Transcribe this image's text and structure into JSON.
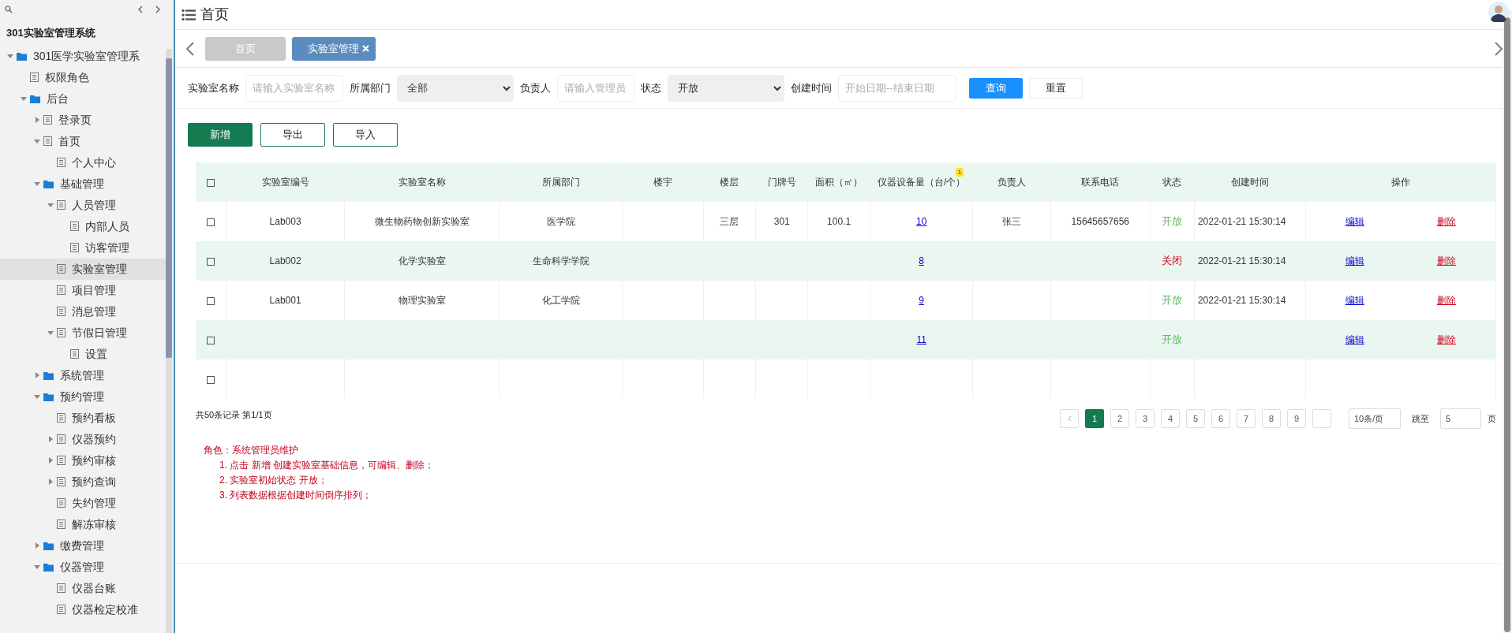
{
  "sidebar": {
    "title": "301实验室管理系统",
    "tree": [
      {
        "label": "301医学实验室管理系",
        "kind": "folder",
        "expanded": true,
        "selected": false,
        "children": [
          {
            "label": "权限角色",
            "kind": "page",
            "selected": false
          },
          {
            "label": "后台",
            "kind": "folder",
            "expanded": true,
            "selected": false,
            "children": [
              {
                "label": "登录页",
                "kind": "page",
                "expanded": false,
                "selected": false
              },
              {
                "label": "首页",
                "kind": "page",
                "expanded": true,
                "selected": false,
                "children": [
                  {
                    "label": "个人中心",
                    "kind": "page",
                    "selected": false
                  }
                ]
              },
              {
                "label": "基础管理",
                "kind": "folder",
                "expanded": true,
                "selected": false,
                "children": [
                  {
                    "label": "人员管理",
                    "kind": "page",
                    "expanded": true,
                    "selected": false,
                    "children": [
                      {
                        "label": "内部人员",
                        "kind": "page",
                        "selected": false
                      },
                      {
                        "label": "访客管理",
                        "kind": "page",
                        "selected": false
                      }
                    ]
                  },
                  {
                    "label": "实验室管理",
                    "kind": "page",
                    "selected": true
                  },
                  {
                    "label": "项目管理",
                    "kind": "page",
                    "selected": false
                  },
                  {
                    "label": "消息管理",
                    "kind": "page",
                    "selected": false
                  },
                  {
                    "label": "节假日管理",
                    "kind": "page",
                    "expanded": true,
                    "selected": false,
                    "children": [
                      {
                        "label": "设置",
                        "kind": "page",
                        "selected": false
                      }
                    ]
                  }
                ]
              },
              {
                "label": "系统管理",
                "kind": "folder",
                "expanded": false,
                "selected": false
              },
              {
                "label": "预约管理",
                "kind": "folder",
                "expanded": true,
                "selected": false,
                "children": [
                  {
                    "label": "预约看板",
                    "kind": "page",
                    "selected": false
                  },
                  {
                    "label": "仪器预约",
                    "kind": "page",
                    "expanded": false,
                    "selected": false
                  },
                  {
                    "label": "预约审核",
                    "kind": "page",
                    "expanded": false,
                    "selected": false
                  },
                  {
                    "label": "预约查询",
                    "kind": "page",
                    "expanded": false,
                    "selected": false
                  },
                  {
                    "label": "失约管理",
                    "kind": "page",
                    "selected": false
                  },
                  {
                    "label": "解冻审核",
                    "kind": "page",
                    "selected": false
                  }
                ]
              },
              {
                "label": "缴费管理",
                "kind": "folder",
                "expanded": false,
                "selected": false
              },
              {
                "label": "仪器管理",
                "kind": "folder",
                "expanded": true,
                "selected": false,
                "children": [
                  {
                    "label": "仪器台账",
                    "kind": "page",
                    "selected": false
                  },
                  {
                    "label": "仪器检定校准",
                    "kind": "page",
                    "selected": false
                  }
                ]
              }
            ]
          }
        ]
      }
    ]
  },
  "header": {
    "title": "首页"
  },
  "tabs": [
    {
      "label": "首页",
      "selected": false,
      "closable": false
    },
    {
      "label": "实验室管理",
      "selected": true,
      "closable": true
    }
  ],
  "filters": [
    {
      "kind": "text",
      "label": "实验室名称",
      "placeholder": "请输入实验室名称"
    },
    {
      "kind": "select",
      "label": "所属部门",
      "value": "全部"
    },
    {
      "kind": "text",
      "label": "负责人",
      "placeholder": "请输入管理员"
    },
    {
      "kind": "select",
      "label": "状态",
      "value": "开放"
    },
    {
      "kind": "text",
      "label": "创建时间",
      "placeholder": "开始日期--结束日期"
    }
  ],
  "search_buttons": [
    {
      "label": "查询",
      "kind": "primary"
    },
    {
      "label": "重置",
      "kind": "plain"
    }
  ],
  "actions": [
    {
      "label": "新增",
      "kind": "solid"
    },
    {
      "label": "导出",
      "kind": "outline"
    },
    {
      "label": "导入",
      "kind": "outline"
    }
  ],
  "table": {
    "select_all": {
      "checked": false
    },
    "columns": [
      {
        "label": "实验室编号"
      },
      {
        "label": "实验室名称"
      },
      {
        "label": "所属部门"
      },
      {
        "label": "楼宇"
      },
      {
        "label": "楼层"
      },
      {
        "label": "门牌号"
      },
      {
        "label": "面积（㎡）"
      },
      {
        "label": "仪器设备量（台/个）",
        "badge": "1"
      },
      {
        "label": "负责人"
      },
      {
        "label": "联系电话"
      },
      {
        "label": "状态"
      },
      {
        "label": "创建时间"
      },
      {
        "label": "操作"
      }
    ],
    "rows": [
      {
        "checked": false,
        "code": "Lab003",
        "name": "微生物药物创新实验室",
        "dept": "医学院",
        "floor": "三层",
        "room": "301",
        "area": "100.1",
        "count": "10",
        "owner": "张三",
        "phone": "15645657656",
        "status": "开放",
        "color": "#5cb85c",
        "created": "2022-01-21 15:30:14",
        "edit": "编辑",
        "delete": "删除"
      },
      {
        "checked": false,
        "code": "Lab002",
        "name": "化学实验室",
        "dept": "生命科学学院",
        "count": "8",
        "status": "关闭",
        "color": "#d0021b",
        "created": "2022-01-21 15:30:14",
        "edit": "编辑",
        "delete": "删除"
      },
      {
        "checked": false,
        "code": "Lab001",
        "name": "物理实验室",
        "dept": "化工学院",
        "count": "9",
        "status": "开放",
        "color": "#5cb85c",
        "created": "2022-01-21 15:30:14",
        "edit": "编辑",
        "delete": "删除"
      },
      {
        "checked": false,
        "count": "11",
        "status": "开放",
        "color": "#5cb85c",
        "edit": "编辑",
        "delete": "删除"
      },
      {
        "checked": false
      }
    ]
  },
  "pagination": {
    "summary": "共50条记录 第1/1页",
    "pages": [
      {
        "label": "1",
        "selected": true
      },
      {
        "label": "2",
        "selected": false
      },
      {
        "label": "3",
        "selected": false
      },
      {
        "label": "4",
        "selected": false
      },
      {
        "label": "5",
        "selected": false
      },
      {
        "label": "6",
        "selected": false
      },
      {
        "label": "7",
        "selected": false
      },
      {
        "label": "8",
        "selected": false
      },
      {
        "label": "9",
        "selected": false
      }
    ],
    "page_size": "10条/页",
    "jump_label": "跳至",
    "jump_value": "5",
    "page_unit": "页"
  },
  "notes": {
    "title": "角色：系统管理员维护",
    "items": [
      "1. 点击 新增 创建实验室基础信息，可编辑、删除；",
      "2. 实验室初始状态 开放；",
      "3. 列表数据根据创建时间倒序排列；"
    ]
  }
}
